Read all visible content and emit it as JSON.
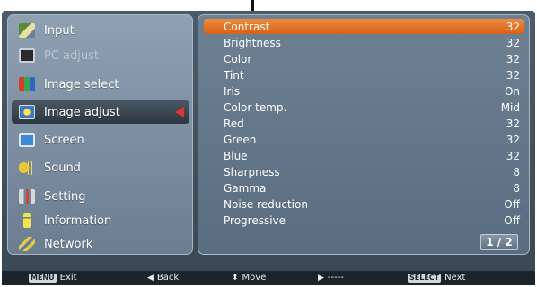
{
  "left_menu": [
    {
      "label": "Input",
      "icon": "input-icon",
      "state": "normal"
    },
    {
      "label": "PC adjust",
      "icon": "pc-adjust-icon",
      "state": "disabled"
    },
    {
      "label": "Image select",
      "icon": "image-select-icon",
      "state": "normal"
    },
    {
      "label": "Image adjust",
      "icon": "image-adjust-icon",
      "state": "selected"
    },
    {
      "label": "Screen",
      "icon": "screen-icon",
      "state": "normal"
    },
    {
      "label": "Sound",
      "icon": "sound-icon",
      "state": "normal"
    },
    {
      "label": "Setting",
      "icon": "setting-icon",
      "state": "normal"
    },
    {
      "label": "Information",
      "icon": "information-icon",
      "state": "normal"
    },
    {
      "label": "Network",
      "icon": "network-icon",
      "state": "normal"
    }
  ],
  "settings": [
    {
      "label": "Contrast",
      "value": "32"
    },
    {
      "label": "Brightness",
      "value": "32"
    },
    {
      "label": "Color",
      "value": "32"
    },
    {
      "label": "Tint",
      "value": "32"
    },
    {
      "label": "Iris",
      "value": "On"
    },
    {
      "label": "Color temp.",
      "value": "Mid"
    },
    {
      "label": "Red",
      "value": "32"
    },
    {
      "label": "Green",
      "value": "32"
    },
    {
      "label": "Blue",
      "value": "32"
    },
    {
      "label": "Sharpness",
      "value": "8"
    },
    {
      "label": "Gamma",
      "value": "8"
    },
    {
      "label": "Noise reduction",
      "value": "Off"
    },
    {
      "label": "Progressive",
      "value": "Off"
    }
  ],
  "page_indicator": "1 / 2",
  "help_bar": {
    "exit_key": "MENU",
    "exit_label": "Exit",
    "back_glyph": "◀",
    "back_label": "Back",
    "move_glyph": "⬍",
    "move_label": "Move",
    "next_glyph": "▶",
    "next_placeholder": "-----",
    "select_key": "SELECT",
    "select_label": "Next"
  },
  "colors": {
    "accent": "#e07a2f",
    "selected_arrow": "#e0332f",
    "panel": "#6e8193"
  }
}
